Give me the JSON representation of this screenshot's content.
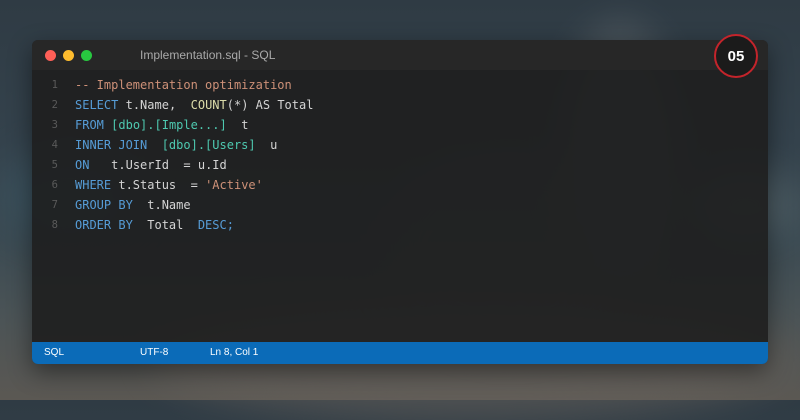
{
  "window": {
    "title": "Implementation.sql - SQL",
    "controls": [
      "close",
      "minimize",
      "maximize"
    ]
  },
  "badge": {
    "text": "05"
  },
  "editor": {
    "line_numbers": [
      "1",
      "2",
      "3",
      "4",
      "5",
      "6",
      "7",
      "8"
    ],
    "lines": [
      {
        "comment": "-- Implementation optimization"
      },
      {
        "kw": "SELECT",
        "cols": "t.Name,",
        "fn": "COUNT",
        "rest": "(*) AS Total"
      },
      {
        "kw": "FROM",
        "table": "[dbo].[Imple...]",
        "alias": "t"
      },
      {
        "kw": "INNER JOIN",
        "table": "[dbo].[Users]",
        "alias": "u"
      },
      {
        "kw": "ON",
        "left": "t.UserId",
        "rest": "= u.Id"
      },
      {
        "kw": "WHERE",
        "col": "t.Status",
        "op": "=",
        "str": "'Active'"
      },
      {
        "kw": "GROUP BY",
        "col": "t.Name"
      },
      {
        "kw": "ORDER BY",
        "col": "Total",
        "dir": "DESC;"
      }
    ]
  },
  "statusbar": {
    "language": "SQL",
    "encoding": "UTF-8",
    "position": "Ln 8, Col 1"
  },
  "colors": {
    "keyword": "#569cd6",
    "function": "#dcdcaa",
    "string": "#ce9178",
    "bracket_identifier": "#4ec9b0",
    "statusbar": "#0b6bb8",
    "badge_ring": "#c4242b"
  }
}
